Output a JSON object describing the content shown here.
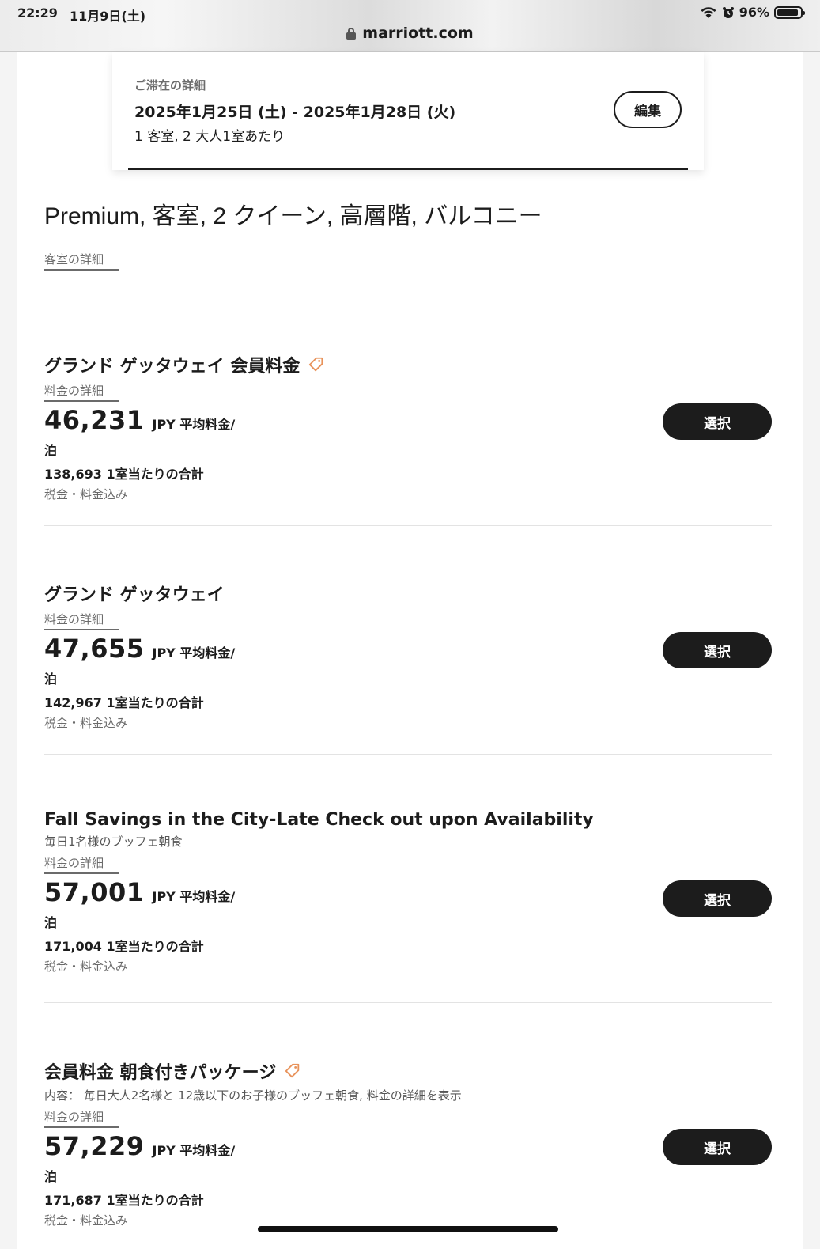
{
  "status_bar": {
    "time": "22:29",
    "date": "11月9日(土)",
    "battery": "96%"
  },
  "browser": {
    "url": "marriott.com"
  },
  "stay": {
    "label": "ご滞在の詳細",
    "dates": "2025年1月25日 (土) - 2025年1月28日 (火)",
    "guests": "1 客室, 2 大人1室あたり",
    "edit_label": "編集"
  },
  "room": {
    "title": "Premium, 客室, 2 クイーン, 高層階, バルコニー",
    "details_link": "客室の詳細"
  },
  "rates": [
    {
      "name": "グランド ゲッタウェイ 会員料金",
      "member_tag": true,
      "description": "",
      "details_link": "料金の詳細",
      "price": "46,231",
      "unit": "JPY 平均料金/",
      "per_night": "泊",
      "total": "138,693 1室当たりの合計",
      "tax": "税金・料金込み",
      "select_label": "選択"
    },
    {
      "name": "グランド ゲッタウェイ",
      "member_tag": false,
      "description": "",
      "details_link": "料金の詳細",
      "price": "47,655",
      "unit": "JPY 平均料金/",
      "per_night": "泊",
      "total": "142,967 1室当たりの合計",
      "tax": "税金・料金込み",
      "select_label": "選択"
    },
    {
      "name": "Fall Savings in the City-Late Check out upon Availability",
      "member_tag": false,
      "description": "毎日1名様のブッフェ朝食",
      "details_link": "料金の詳細",
      "price": "57,001",
      "unit": "JPY 平均料金/",
      "per_night": "泊",
      "total": "171,004 1室当たりの合計",
      "tax": "税金・料金込み",
      "select_label": "選択"
    },
    {
      "name": "会員料金 朝食付きパッケージ",
      "member_tag": true,
      "description": "内容： 毎日大人2名様と 12歳以下のお子様のブッフェ朝食, 料金の詳細を表示",
      "details_link": "料金の詳細",
      "price": "57,229",
      "unit": "JPY 平均料金/",
      "per_night": "泊",
      "total": "171,687 1室当たりの合計",
      "tax": "税金・料金込み",
      "select_label": "選択"
    }
  ],
  "colors": {
    "accent_tag": "#e8925a",
    "button": "#1c1c1c"
  }
}
